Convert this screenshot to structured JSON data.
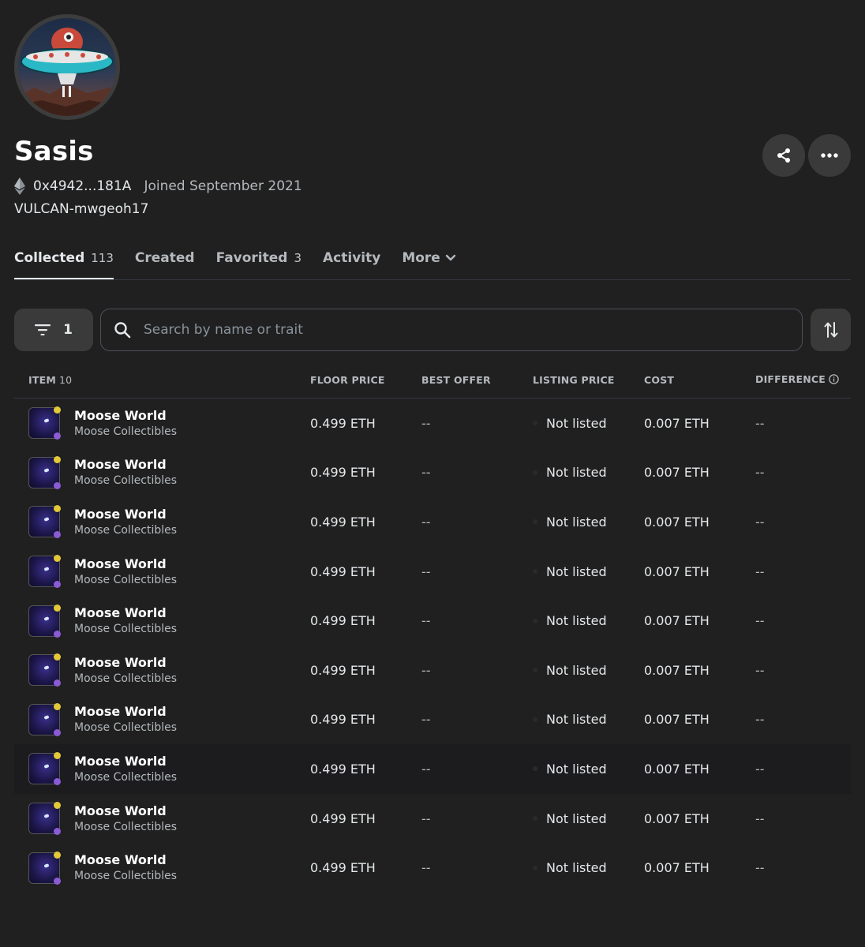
{
  "profile": {
    "name": "Sasis",
    "address": "0x4942...181A",
    "joined": "Joined September 2021",
    "username": "VULCAN-mwgeoh17"
  },
  "actions": {
    "share_icon": "share-icon",
    "more_icon": "more-horizontal-icon"
  },
  "tabs": [
    {
      "label": "Collected",
      "count": "113"
    },
    {
      "label": "Created",
      "count": ""
    },
    {
      "label": "Favorited",
      "count": "3"
    },
    {
      "label": "Activity",
      "count": ""
    },
    {
      "label": "More",
      "count": ""
    }
  ],
  "filter": {
    "count": "1"
  },
  "search": {
    "placeholder": "Search by name or trait"
  },
  "table": {
    "headers": {
      "item": "ITEM",
      "item_count": "10",
      "floor": "FLOOR PRICE",
      "offer": "BEST OFFER",
      "listing": "LISTING PRICE",
      "cost": "COST",
      "difference": "DIFFERENCE"
    },
    "rows": [
      {
        "name": "Moose World",
        "collection": "Moose Collectibles",
        "floor": "0.499 ETH",
        "offer": "--",
        "listing": "Not listed",
        "cost": "0.007 ETH",
        "difference": "--"
      },
      {
        "name": "Moose World",
        "collection": "Moose Collectibles",
        "floor": "0.499 ETH",
        "offer": "--",
        "listing": "Not listed",
        "cost": "0.007 ETH",
        "difference": "--"
      },
      {
        "name": "Moose World",
        "collection": "Moose Collectibles",
        "floor": "0.499 ETH",
        "offer": "--",
        "listing": "Not listed",
        "cost": "0.007 ETH",
        "difference": "--"
      },
      {
        "name": "Moose World",
        "collection": "Moose Collectibles",
        "floor": "0.499 ETH",
        "offer": "--",
        "listing": "Not listed",
        "cost": "0.007 ETH",
        "difference": "--"
      },
      {
        "name": "Moose World",
        "collection": "Moose Collectibles",
        "floor": "0.499 ETH",
        "offer": "--",
        "listing": "Not listed",
        "cost": "0.007 ETH",
        "difference": "--"
      },
      {
        "name": "Moose World",
        "collection": "Moose Collectibles",
        "floor": "0.499 ETH",
        "offer": "--",
        "listing": "Not listed",
        "cost": "0.007 ETH",
        "difference": "--"
      },
      {
        "name": "Moose World",
        "collection": "Moose Collectibles",
        "floor": "0.499 ETH",
        "offer": "--",
        "listing": "Not listed",
        "cost": "0.007 ETH",
        "difference": "--"
      },
      {
        "name": "Moose World",
        "collection": "Moose Collectibles",
        "floor": "0.499 ETH",
        "offer": "--",
        "listing": "Not listed",
        "cost": "0.007 ETH",
        "difference": "--"
      },
      {
        "name": "Moose World",
        "collection": "Moose Collectibles",
        "floor": "0.499 ETH",
        "offer": "--",
        "listing": "Not listed",
        "cost": "0.007 ETH",
        "difference": "--"
      },
      {
        "name": "Moose World",
        "collection": "Moose Collectibles",
        "floor": "0.499 ETH",
        "offer": "--",
        "listing": "Not listed",
        "cost": "0.007 ETH",
        "difference": "--"
      }
    ]
  }
}
